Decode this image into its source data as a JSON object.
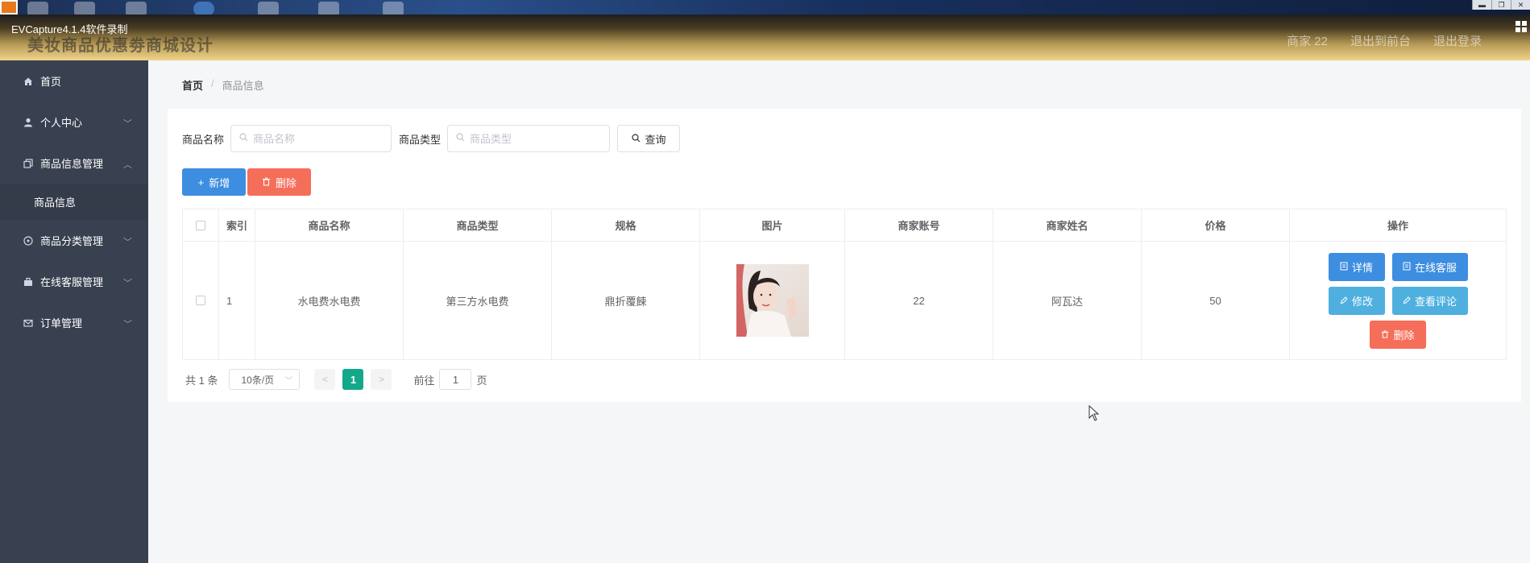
{
  "recorder": {
    "title": "EVCapture4.1.4软件录制"
  },
  "header": {
    "system_title": "美妆商品优惠劵商城设计",
    "user_label": "商家 22",
    "back_label": "退出到前台",
    "logout_label": "退出登录"
  },
  "sidebar": {
    "items": [
      {
        "label": "首页"
      },
      {
        "label": "个人中心"
      },
      {
        "label": "商品信息管理"
      },
      {
        "label": "商品分类管理"
      },
      {
        "label": "在线客服管理"
      },
      {
        "label": "订单管理"
      }
    ],
    "sub_item": {
      "label": "商品信息"
    }
  },
  "breadcrumb": {
    "home": "首页",
    "separator": "/",
    "current": "商品信息"
  },
  "search": {
    "name_label": "商品名称",
    "name_placeholder": "商品名称",
    "type_label": "商品类型",
    "type_placeholder": "商品类型",
    "query_label": "查询"
  },
  "actions": {
    "add_label": "新增",
    "delete_label": "删除"
  },
  "table": {
    "columns": [
      "索引",
      "商品名称",
      "商品类型",
      "规格",
      "图片",
      "商家账号",
      "商家姓名",
      "价格",
      "操作"
    ],
    "rows": [
      {
        "index": "1",
        "name": "水电费水电费",
        "type": "第三方水电费",
        "spec": "鼎折覆餗",
        "merchant_account": "22",
        "merchant_name": "阿瓦达",
        "price": "50",
        "ops": {
          "detail": "详情",
          "service": "在线客服",
          "edit": "修改",
          "comments": "查看评论",
          "delete": "删除"
        }
      }
    ]
  },
  "pagination": {
    "total": "共 1 条",
    "page_size": "10条/页",
    "current_page": "1",
    "goto_label": "前往",
    "goto_value": "1",
    "page_unit": "页"
  },
  "colors": {
    "primary": "#3d8ee0",
    "danger": "#f56e5a",
    "info": "#4fb0e0",
    "pager_active": "#14a88b",
    "sidebar": "#394150"
  }
}
